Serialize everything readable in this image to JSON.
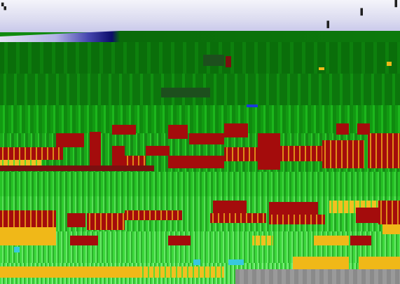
{
  "scene": {
    "colors": {
      "sky_light": "#f4f4fa",
      "sky_dark": "#0c0c6a",
      "field_dark_green": "#0a6e0a",
      "field_light_green": "#48e048",
      "crop_red": "#a40c0c",
      "crop_yellow": "#f0b818",
      "ground_grey": "#8a8a8a"
    }
  }
}
